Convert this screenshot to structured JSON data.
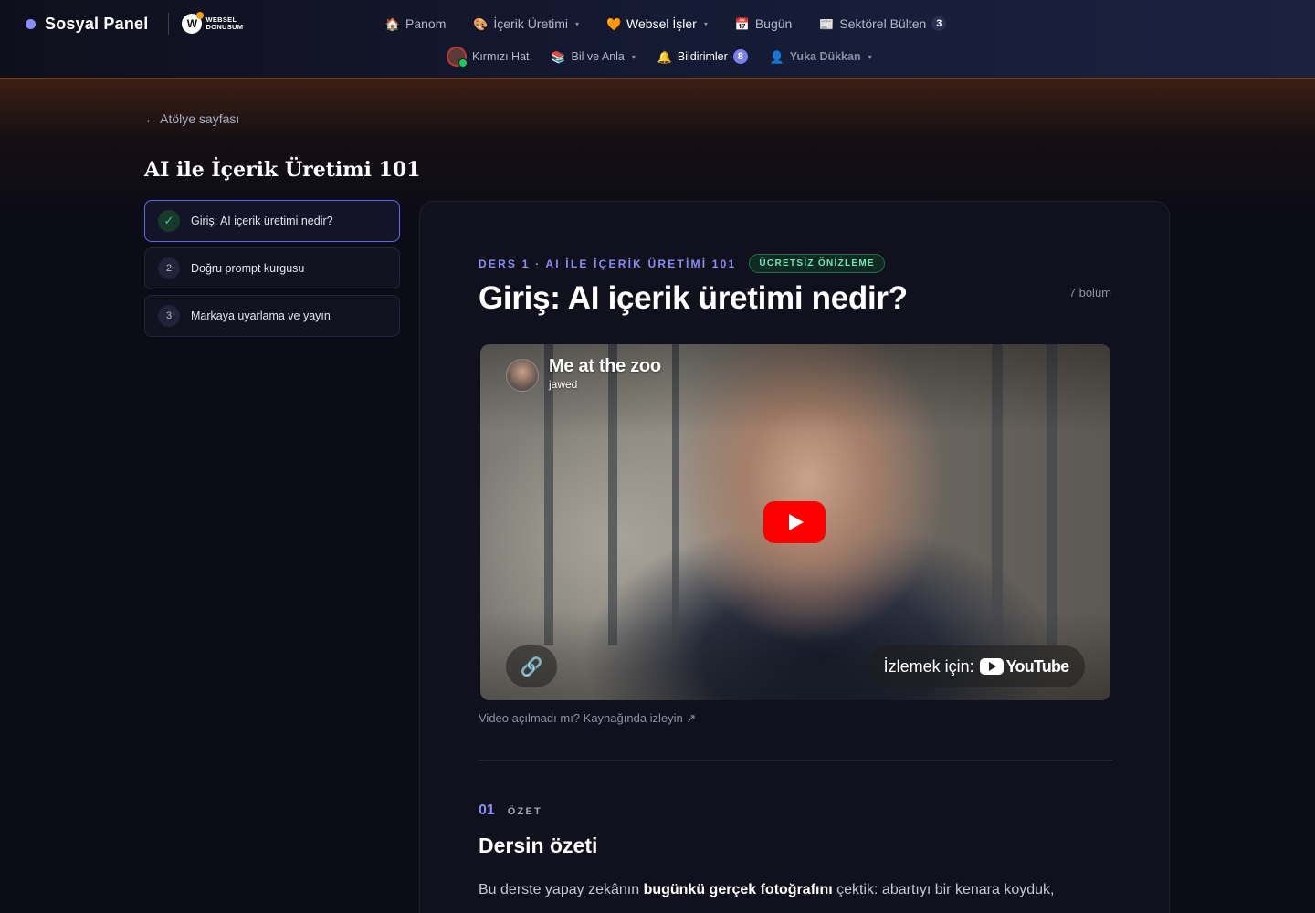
{
  "header": {
    "brand": "Sosyal Panel",
    "partner_logo_line1": "WEBSEL",
    "partner_logo_line2": "DONUSUM",
    "nav_primary": [
      {
        "icon": "house-icon",
        "glyph": "🏠",
        "label": "Panom"
      },
      {
        "icon": "palette-icon",
        "glyph": "🎨",
        "label": "İçerik Üretimi",
        "caret": true
      },
      {
        "icon": "heart-icon",
        "glyph": "🧡",
        "label": "Websel İşler",
        "caret": true,
        "active": true
      },
      {
        "icon": "calendar-icon",
        "glyph": "📅",
        "label": "Bugün"
      },
      {
        "icon": "newspaper-icon",
        "glyph": "📰",
        "label": "Sektörel Bülten",
        "badge": "3"
      }
    ],
    "nav_secondary": [
      {
        "icon": "avatar",
        "label": "Kırmızı Hat"
      },
      {
        "icon": "books-icon",
        "glyph": "📚",
        "label": "Bil ve Anla",
        "caret": true
      },
      {
        "icon": "bell-icon",
        "glyph": "🔔",
        "label": "Bildirimler",
        "badge": "8"
      },
      {
        "icon": "user-icon",
        "glyph": "👤",
        "label": "Yuka Dükkan",
        "caret": true
      }
    ]
  },
  "sidebar": {
    "back_label": "← Atölye sayfası",
    "course_title": "AI ile İçerik Üretimi 101",
    "lessons": [
      {
        "num": "✓",
        "label": "Giriş: AI içerik üretimi nedir?",
        "active": true
      },
      {
        "num": "2",
        "label": "Doğru prompt kurgusu"
      },
      {
        "num": "3",
        "label": "Markaya uyarlama ve yayın"
      }
    ]
  },
  "main": {
    "eyebrow": "DERS 1 · AI İLE İÇERİK ÜRETİMİ 101",
    "free_badge": "ÜCRETSİZ ÖNİZLEME",
    "title": "Giriş: AI içerik üretimi nedir?",
    "chapter_count": "7 bölüm",
    "video": {
      "title": "Me at the zoo",
      "channel": "jawed",
      "watch_label": "İzlemek için:",
      "platform": "YouTube"
    },
    "video_fallback": "Video açılmadı mı? Kaynağında izleyin ↗",
    "section": {
      "num": "01",
      "tag": "ÖZET",
      "title": "Dersin özeti",
      "body_pre": "Bu derste yapay zekânın ",
      "body_bold": "bugünkü gerçek fotoğrafını",
      "body_post": " çektik: abartıyı bir kenara koyduk,"
    }
  },
  "colors": {
    "accent": "#8b8cf6",
    "success": "#34d399",
    "youtube_red": "#ff0000"
  }
}
